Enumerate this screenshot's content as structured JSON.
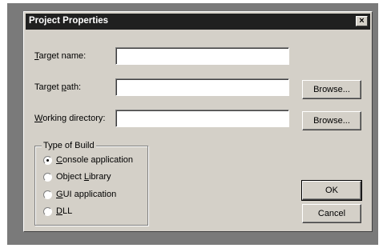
{
  "window": {
    "title": "Project Properties",
    "close_glyph": "×"
  },
  "fields": {
    "target_name": {
      "label_pre": "",
      "label_key": "T",
      "label_post": "arget name:",
      "value": ""
    },
    "target_path": {
      "label_pre": "Target ",
      "label_key": "p",
      "label_post": "ath:",
      "value": ""
    },
    "working_dir": {
      "label_pre": "",
      "label_key": "W",
      "label_post": "orking directory:",
      "value": ""
    }
  },
  "buttons": {
    "browse_path": "Browse...",
    "browse_dir": "Browse...",
    "ok": "OK",
    "cancel": "Cancel"
  },
  "build_type": {
    "title": "Type of Build",
    "selected": "Console application",
    "options": [
      {
        "pre": "",
        "key": "C",
        "post": "onsole application",
        "checked": true
      },
      {
        "pre": "Object ",
        "key": "L",
        "post": "ibrary",
        "checked": false
      },
      {
        "pre": "",
        "key": "G",
        "post": "UI application",
        "checked": false
      },
      {
        "pre": "",
        "key": "D",
        "post": "LL",
        "checked": false
      }
    ]
  },
  "icons": {
    "close": "close-icon",
    "radio_selected": "radio-selected-icon",
    "radio_empty": "radio-empty-icon"
  }
}
